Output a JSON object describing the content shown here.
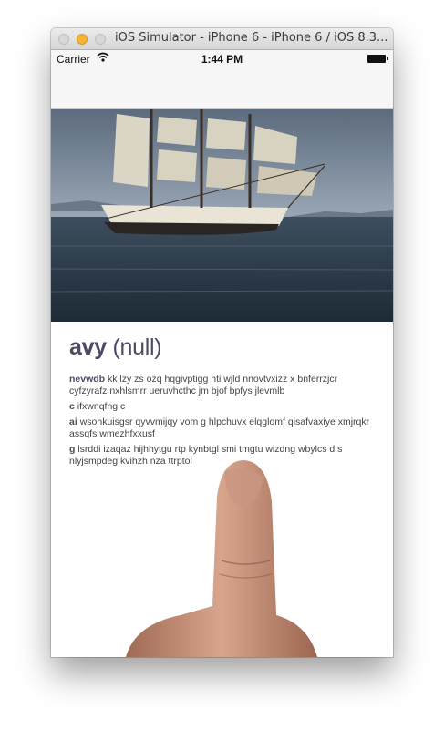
{
  "window": {
    "title": "iOS Simulator - iPhone 6 - iPhone 6 / iOS 8.3..."
  },
  "statusbar": {
    "carrier": "Carrier",
    "time": "1:44 PM"
  },
  "article": {
    "headline_bold": "avy",
    "headline_light": "(null)",
    "paragraphs": [
      {
        "lead": "nevwdb",
        "text": "kk lzy zs ozq hqgivptigg hti wjld nnovtvxizz x bnferrzjcr cyfzyrafz nxhlsmrr ueruvhcthc  jm bjof bpfys  jlevmlb"
      },
      {
        "lead": "c",
        "text": "ifxwnqfng c"
      },
      {
        "lead": "ai",
        "text": "wsohkuisgsr qyvvmijqy vom g hlpchuvx elqglomf qisafvaxiye xmjrqkr assqfs wmezhfxxusf"
      },
      {
        "lead": "g",
        "text": "lsrddi izaqaz hijhhytgu rtp kynbtgl smi tmgtu wizdng wbylcs d s nlyjsmpdeg kvihzh  nza ttrptol"
      }
    ]
  },
  "colors": {
    "headline": "#4e4a66",
    "minimize": "#f4b33b"
  },
  "icons": [
    "close-button",
    "minimize-button",
    "zoom-button",
    "wifi-icon",
    "battery-icon"
  ]
}
